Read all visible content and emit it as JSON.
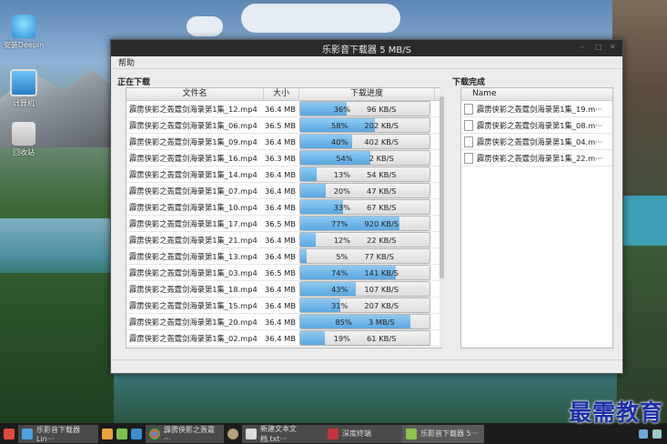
{
  "desktop": {
    "icons": [
      {
        "label": "安装Deepin"
      },
      {
        "label": "计算机"
      },
      {
        "label": "回收站"
      }
    ]
  },
  "window": {
    "title": "乐影音下载器  5 MB/S",
    "menu": {
      "help": "帮助"
    },
    "downloading": {
      "section_title": "正在下载",
      "columns": {
        "name": "文件名",
        "size": "大小",
        "progress": "下载进度"
      },
      "rows": [
        {
          "name": "霹雳侠影之轰霆剑海录第1集_12.mp4",
          "size": "36.4 MB",
          "percent": 36,
          "percent_text": "36%",
          "speed": "96 KB/S"
        },
        {
          "name": "霹雳侠影之轰霆剑海录第1集_06.mp4",
          "size": "36.5 MB",
          "percent": 58,
          "percent_text": "58%",
          "speed": "202 KB/S"
        },
        {
          "name": "霹雳侠影之轰霆剑海录第1集_09.mp4",
          "size": "36.4 MB",
          "percent": 40,
          "percent_text": "40%",
          "speed": "402 KB/S"
        },
        {
          "name": "霹雳侠影之轰霆剑海录第1集_16.mp4",
          "size": "36.3 MB",
          "percent": 54,
          "percent_text": "54%",
          "speed": "2 KB/S"
        },
        {
          "name": "霹雳侠影之轰霆剑海录第1集_14.mp4",
          "size": "36.4 MB",
          "percent": 13,
          "percent_text": "13%",
          "speed": "54 KB/S"
        },
        {
          "name": "霹雳侠影之轰霆剑海录第1集_07.mp4",
          "size": "36.4 MB",
          "percent": 20,
          "percent_text": "20%",
          "speed": "47 KB/S"
        },
        {
          "name": "霹雳侠影之轰霆剑海录第1集_10.mp4",
          "size": "36.4 MB",
          "percent": 33,
          "percent_text": "33%",
          "speed": "67 KB/S"
        },
        {
          "name": "霹雳侠影之轰霆剑海录第1集_17.mp4",
          "size": "36.5 MB",
          "percent": 77,
          "percent_text": "77%",
          "speed": "920 KB/S"
        },
        {
          "name": "霹雳侠影之轰霆剑海录第1集_21.mp4",
          "size": "36.4 MB",
          "percent": 12,
          "percent_text": "12%",
          "speed": "22 KB/S"
        },
        {
          "name": "霹雳侠影之轰霆剑海录第1集_13.mp4",
          "size": "36.4 MB",
          "percent": 5,
          "percent_text": "5%",
          "speed": "77 KB/S"
        },
        {
          "name": "霹雳侠影之轰霆剑海录第1集_03.mp4",
          "size": "36.5 MB",
          "percent": 74,
          "percent_text": "74%",
          "speed": "141 KB/S"
        },
        {
          "name": "霹雳侠影之轰霆剑海录第1集_18.mp4",
          "size": "36.4 MB",
          "percent": 43,
          "percent_text": "43%",
          "speed": "107 KB/S"
        },
        {
          "name": "霹雳侠影之轰霆剑海录第1集_15.mp4",
          "size": "36.4 MB",
          "percent": 31,
          "percent_text": "31%",
          "speed": "207 KB/S"
        },
        {
          "name": "霹雳侠影之轰霆剑海录第1集_20.mp4",
          "size": "36.4 MB",
          "percent": 85,
          "percent_text": "85%",
          "speed": "3 MB/S"
        },
        {
          "name": "霹雳侠影之轰霆剑海录第1集_02.mp4",
          "size": "36.4 MB",
          "percent": 19,
          "percent_text": "19%",
          "speed": "61 KB/S"
        }
      ]
    },
    "completed": {
      "section_title": "下载完成",
      "column": "Name",
      "items": [
        {
          "name": "霹雳侠影之轰霆剑海录第1集_19.m···"
        },
        {
          "name": "霹雳侠影之轰霆剑海录第1集_08.m···"
        },
        {
          "name": "霹雳侠影之轰霆剑海录第1集_04.m···"
        },
        {
          "name": "霹雳侠影之轰霆剑海录第1集_22.m···"
        }
      ]
    }
  },
  "taskbar": {
    "items": [
      {
        "label": "乐影音下载器Lin···",
        "icon": "folder-icon"
      },
      {
        "label": "霹雳侠影之轰霆···",
        "icon": "chrome-icon"
      },
      {
        "label": "新建文本文档.txt···",
        "icon": "text-editor-icon"
      },
      {
        "label": "深度终端",
        "icon": "terminal-icon"
      },
      {
        "label": "乐影音下载器 5···",
        "icon": "downloader-icon"
      }
    ]
  },
  "watermark": "最需教育",
  "colors": {
    "progress_fill": "#5aa7e0",
    "titlebar": "#2a2a2a",
    "taskbar": "#1c1c1c"
  }
}
